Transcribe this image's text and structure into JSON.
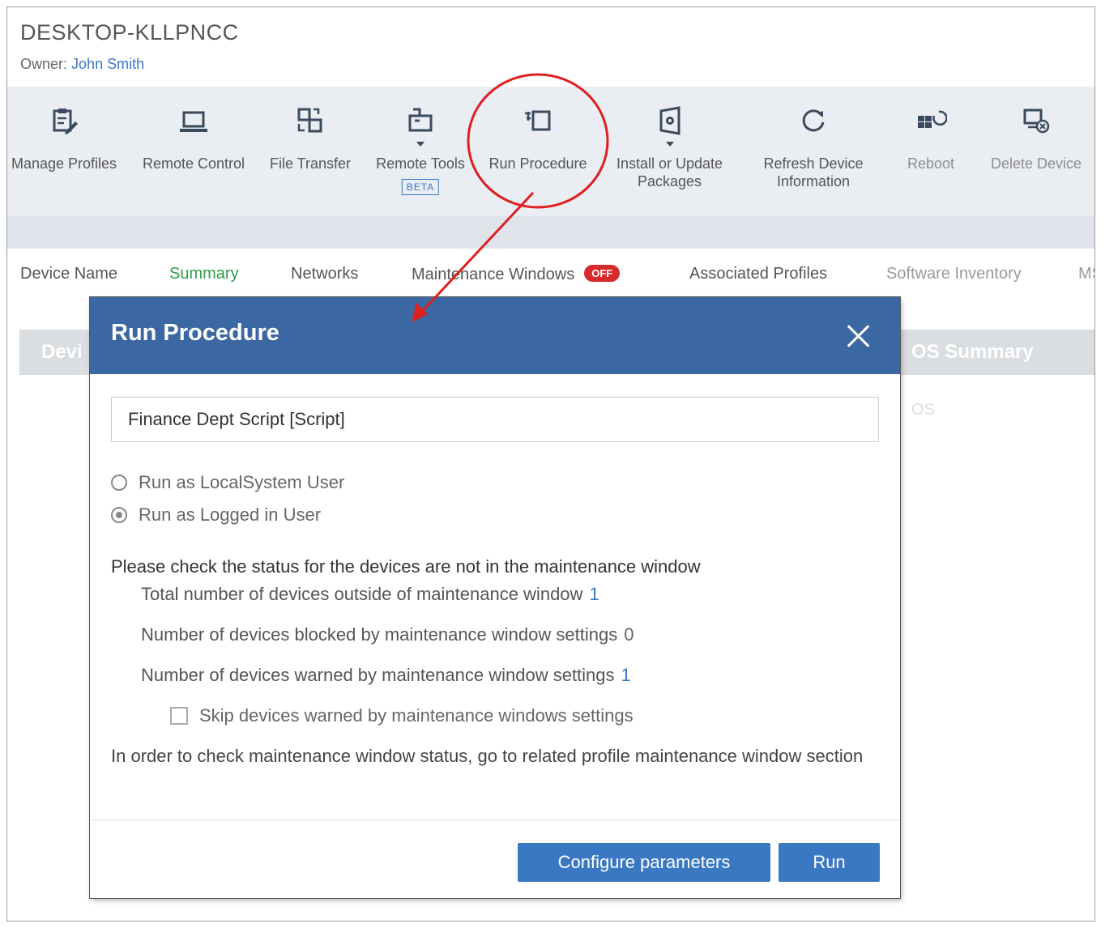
{
  "device": {
    "title": "DESKTOP-KLLPNCC",
    "owner_label": "Owner:",
    "owner_name": "John Smith"
  },
  "toolbar": [
    {
      "label": "Manage Profiles",
      "icon": "manage-profiles-icon"
    },
    {
      "label": "Remote Control",
      "icon": "laptop-icon"
    },
    {
      "label": "File Transfer",
      "icon": "file-transfer-icon"
    },
    {
      "label": "Remote Tools",
      "icon": "remote-tools-icon",
      "badge": "BETA"
    },
    {
      "label": "Run Procedure",
      "icon": "run-procedure-icon"
    },
    {
      "label_line1": "Install or Update",
      "label_line2": "Packages",
      "icon": "package-icon"
    },
    {
      "label_line1": "Refresh Device",
      "label_line2": "Information",
      "icon": "refresh-icon"
    },
    {
      "label": "Reboot",
      "icon": "reboot-icon"
    },
    {
      "label": "Delete Device",
      "icon": "delete-device-icon"
    }
  ],
  "tabs": [
    {
      "label": "Device Name"
    },
    {
      "label": "Summary",
      "active": true
    },
    {
      "label": "Networks"
    },
    {
      "label": "Maintenance Windows",
      "badge": "OFF"
    },
    {
      "label": "Associated Profiles"
    },
    {
      "label": "Software Inventory"
    },
    {
      "label": "MS"
    }
  ],
  "background_table": {
    "col_device": "Devi",
    "col_os": "OS Summary",
    "os_value": "OS"
  },
  "modal": {
    "title": "Run Procedure",
    "procedure_value": "Finance Dept Script [Script]",
    "radio_localsystem": "Run as LocalSystem User",
    "radio_loggedin": "Run as Logged in User",
    "status_heading": "Please check the status for the devices are not in the maintenance window",
    "outside_label": "Total number of devices outside of maintenance window",
    "outside_count": "1",
    "blocked_label": "Number of devices blocked by maintenance window settings",
    "blocked_count": "0",
    "warned_label": "Number of devices warned by maintenance window settings",
    "warned_count": "1",
    "skip_label": "Skip devices warned by maintenance windows settings",
    "info_text": "In order to check maintenance window status, go to related profile maintenance window section",
    "configure_button": "Configure parameters",
    "run_button": "Run"
  },
  "colors": {
    "header_blue": "#3b68a3",
    "button_blue": "#3b78c4",
    "link_blue": "#3a77c8",
    "active_tab_green": "#2e9e49",
    "badge_red": "#d82a2a",
    "annotation_red": "#e02020"
  }
}
